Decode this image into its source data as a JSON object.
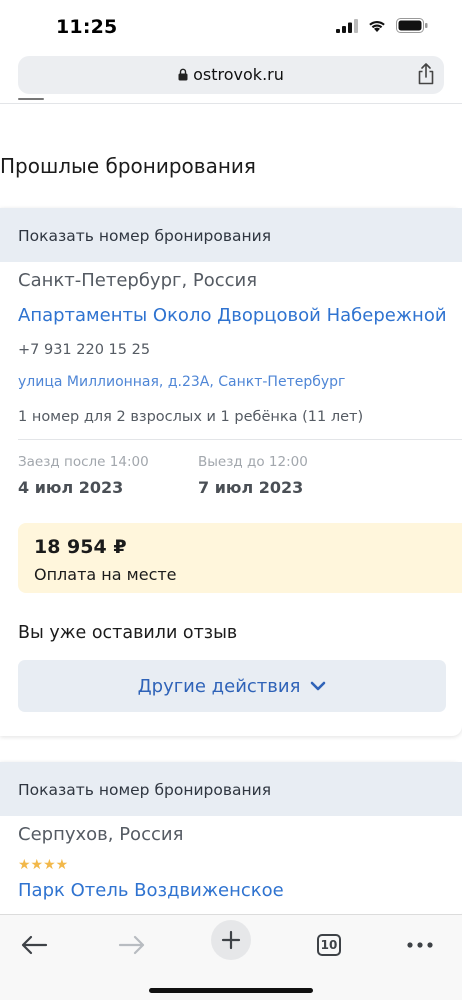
{
  "status": {
    "time": "11:25"
  },
  "browser": {
    "url": "ostrovok.ru",
    "tabs_count": "10"
  },
  "page": {
    "section_title": "Прошлые бронирования"
  },
  "bookings": [
    {
      "show_number_label": "Показать номер бронирования",
      "location": "Санкт-Петербург, Россия",
      "hotel_name": "Апартаменты Около Дворцовой Набережной",
      "phone": "+7 931 220 15 25",
      "address": "улица Миллионная, д.23А, Санкт-Петербург",
      "rooms": "1 номер для 2 взрослых и 1 ребёнка (11 лет)",
      "checkin_label": "Заезд после 14:00",
      "checkin_date": "4 июл 2023",
      "checkout_label": "Выезд до 12:00",
      "checkout_date": "7 июл 2023",
      "price": "18 954 ₽",
      "payment_note": "Оплата на месте",
      "review_note": "Вы уже оставили отзыв",
      "actions_label": "Другие действия"
    },
    {
      "show_number_label": "Показать номер бронирования",
      "location": "Серпухов, Россия",
      "stars": "★★★★",
      "star_rating": 4,
      "hotel_name": "Парк Отель Воздвиженское"
    }
  ],
  "colors": {
    "link": "#2f73d0",
    "header_bg": "#e8edf3",
    "price_bg": "#fff6dc",
    "stars": "#f2b84a"
  },
  "icons": {
    "status": [
      "signal-icon",
      "wifi-icon",
      "battery-icon"
    ],
    "url_bar": [
      "lock-icon",
      "share-icon"
    ],
    "toolbar": [
      "back-icon",
      "forward-icon",
      "new-tab-icon",
      "tabs-icon",
      "more-icon"
    ]
  }
}
